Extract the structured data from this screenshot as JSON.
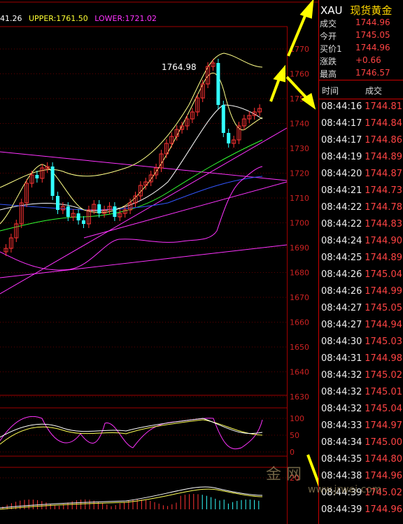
{
  "header": {
    "mid": "41.26",
    "upper": "UPPER:1761.50",
    "lower": "LOWER:1721.02"
  },
  "colors": {
    "grid": "#a00000",
    "red": "#ff3333",
    "cyan": "#33ffff",
    "yellow": "#ffff33",
    "magenta": "#ff33ff",
    "green": "#33ff33",
    "blue": "#3355ff",
    "white": "#ffffff",
    "arrow": "#ffff00"
  },
  "annotation": {
    "peak_label": "1764.98"
  },
  "price_axis": {
    "labels": [
      "1770",
      "1760",
      "1750",
      "1740",
      "1730",
      "1720",
      "1710",
      "1700",
      "1690",
      "1680",
      "1670",
      "1660",
      "1650",
      "1640",
      "1630"
    ]
  },
  "osc1_axis": {
    "labels": [
      "100",
      "50",
      "0"
    ]
  },
  "osc2_axis": {
    "labels": [
      "20"
    ]
  },
  "panel": {
    "symbol": "XAU",
    "name": "现货黄金",
    "quote": [
      {
        "label": "成交",
        "value": "1744.96"
      },
      {
        "label": "今开",
        "value": "1745.05"
      },
      {
        "label": "买价1",
        "value": "1744.96"
      },
      {
        "label": "涨跌",
        "value": "+0.66"
      },
      {
        "label": "最高",
        "value": "1746.57"
      }
    ],
    "table_header": {
      "time": "时间",
      "price": "成交"
    },
    "ticks": [
      {
        "time": "08:44:16",
        "price": "1744.81"
      },
      {
        "time": "08:44:17",
        "price": "1744.84"
      },
      {
        "time": "08:44:17",
        "price": "1744.86"
      },
      {
        "time": "08:44:19",
        "price": "1744.89"
      },
      {
        "time": "08:44:20",
        "price": "1744.87"
      },
      {
        "time": "08:44:21",
        "price": "1744.73"
      },
      {
        "time": "08:44:22",
        "price": "1744.78"
      },
      {
        "time": "08:44:22",
        "price": "1744.83"
      },
      {
        "time": "08:44:24",
        "price": "1744.90"
      },
      {
        "time": "08:44:25",
        "price": "1744.89"
      },
      {
        "time": "08:44:26",
        "price": "1745.04"
      },
      {
        "time": "08:44:26",
        "price": "1744.99"
      },
      {
        "time": "08:44:27",
        "price": "1745.05"
      },
      {
        "time": "08:44:27",
        "price": "1744.94"
      },
      {
        "time": "08:44:30",
        "price": "1745.03"
      },
      {
        "time": "08:44:31",
        "price": "1744.98"
      },
      {
        "time": "08:44:32",
        "price": "1745.02"
      },
      {
        "time": "08:44:32",
        "price": "1745.01"
      },
      {
        "time": "08:44:32",
        "price": "1745.04"
      },
      {
        "time": "08:44:33",
        "price": "1744.97"
      },
      {
        "time": "08:44:34",
        "price": "1745.00"
      },
      {
        "time": "08:44:35",
        "price": "1744.80"
      },
      {
        "time": "08:44:38",
        "price": "1744.96"
      },
      {
        "time": "08:44:39",
        "price": "1745.02"
      },
      {
        "time": "08:44:39",
        "price": "1744.96"
      }
    ]
  },
  "watermark": {
    "text": "金 网",
    "url": "www.jrwei.com"
  }
}
